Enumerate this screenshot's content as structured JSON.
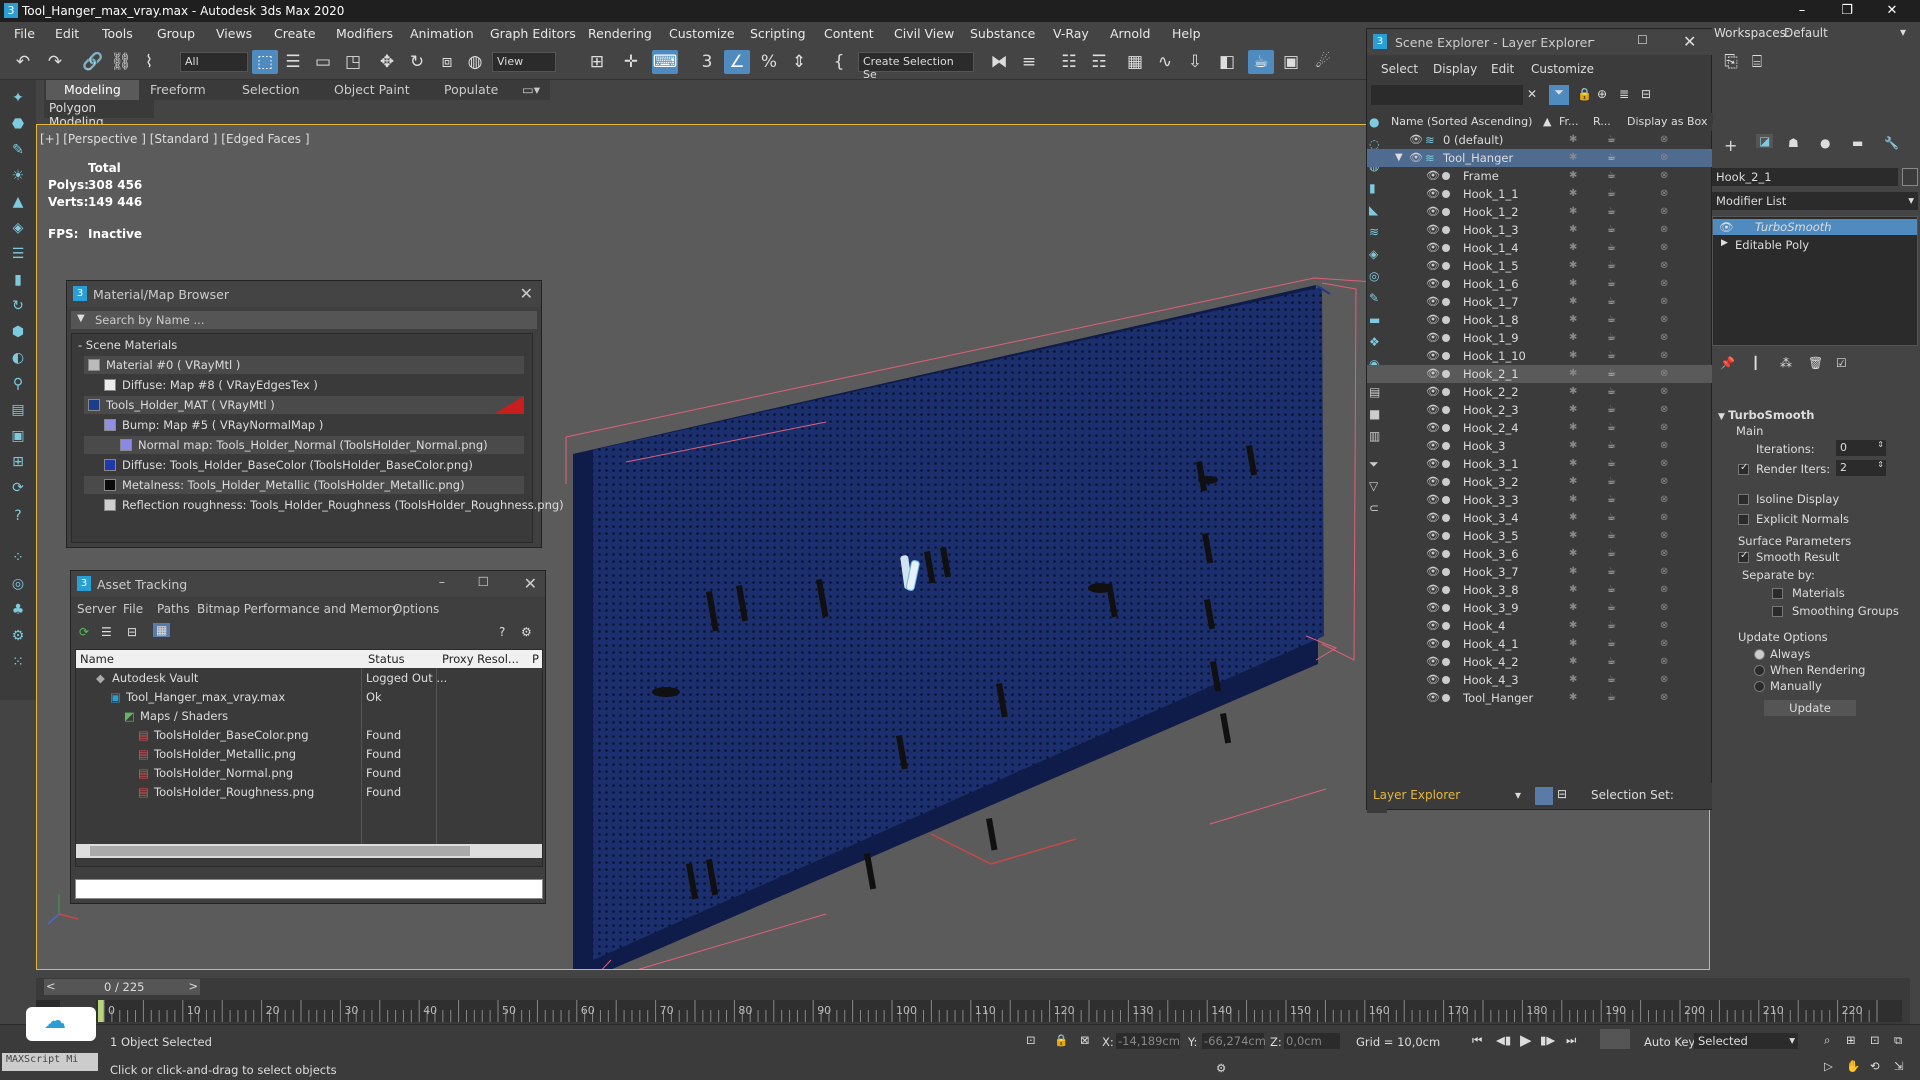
{
  "titlebar": {
    "title": "Tool_Hanger_max_vray.max - Autodesk 3ds Max 2020"
  },
  "menu": [
    "File",
    "Edit",
    "Tools",
    "Group",
    "Views",
    "Create",
    "Modifiers",
    "Animation",
    "Graph Editors",
    "Rendering",
    "Customize",
    "Scripting",
    "Content",
    "Civil View",
    "Substance",
    "V-Ray",
    "Arnold",
    "Help"
  ],
  "workspace": {
    "label": "Workspaces:",
    "value": "Default"
  },
  "toolbar": {
    "filter": "All",
    "view": "View",
    "selection_set": "Create Selection Se"
  },
  "ribbon": {
    "tabs": [
      "Modeling",
      "Freeform",
      "Selection",
      "Object Paint",
      "Populate"
    ],
    "sub": "Polygon Modeling"
  },
  "viewport": {
    "label": "[+] [Perspective ] [Standard ] [Edged Faces ]",
    "total": "Total",
    "polys_label": "Polys:",
    "polys": "308 456",
    "verts_label": "Verts:",
    "verts": "149 446",
    "fps_label": "FPS:",
    "fps": "Inactive"
  },
  "material_browser": {
    "title": "Material/Map Browser",
    "search": "Search by Name ...",
    "section": "- Scene Materials",
    "items": [
      {
        "label": "Material #0  ( VRayMtl )",
        "swatch": "#bbbbbb"
      },
      {
        "label": "Diffuse: Map #8  ( VRayEdgesTex )",
        "swatch": "#ececec"
      },
      {
        "label": "Tools_Holder_MAT  ( VRayMtl )",
        "swatch": "#1c3c8c"
      },
      {
        "label": "Bump: Map #5  ( VRayNormalMap )",
        "swatch": "#9090e0"
      },
      {
        "label": "Normal map: Tools_Holder_Normal (ToolsHolder_Normal.png)",
        "swatch": "#8a8ae6"
      },
      {
        "label": "Diffuse: Tools_Holder_BaseColor (ToolsHolder_BaseColor.png)",
        "swatch": "#1d3aa8"
      },
      {
        "label": "Metalness: Tools_Holder_Metallic (ToolsHolder_Metallic.png)",
        "swatch": "#0a0a0a"
      },
      {
        "label": "Reflection roughness: Tools_Holder_Roughness (ToolsHolder_Roughness.png)",
        "swatch": "#cfcfcf"
      }
    ]
  },
  "asset_tracking": {
    "title": "Asset Tracking",
    "menu": [
      "Server",
      "File",
      "Paths",
      "Bitmap Performance and Memory",
      "Options"
    ],
    "columns": [
      "Name",
      "Status",
      "Proxy Resol...",
      "P"
    ],
    "rows": [
      {
        "name": "Autodesk Vault",
        "status": "Logged Out ..."
      },
      {
        "name": "Tool_Hanger_max_vray.max",
        "status": "Ok"
      },
      {
        "name": "Maps / Shaders",
        "status": ""
      },
      {
        "name": "ToolsHolder_BaseColor.png",
        "status": "Found"
      },
      {
        "name": "ToolsHolder_Metallic.png",
        "status": "Found"
      },
      {
        "name": "ToolsHolder_Normal.png",
        "status": "Found"
      },
      {
        "name": "ToolsHolder_Roughness.png",
        "status": "Found"
      }
    ]
  },
  "scene_explorer": {
    "title": "Scene Explorer - Layer Explorer",
    "menu": [
      "Select",
      "Display",
      "Edit",
      "Customize"
    ],
    "columns": [
      "Name (Sorted Ascending)",
      "Fr...",
      "R...",
      "Display as Box"
    ],
    "layer_default": "0 (default)",
    "layer_tool": "Tool_Hanger",
    "objects": [
      "Frame",
      "Hook_1_1",
      "Hook_1_2",
      "Hook_1_3",
      "Hook_1_4",
      "Hook_1_5",
      "Hook_1_6",
      "Hook_1_7",
      "Hook_1_8",
      "Hook_1_9",
      "Hook_1_10",
      "Hook_2_1",
      "Hook_2_2",
      "Hook_2_3",
      "Hook_2_4",
      "Hook_3",
      "Hook_3_1",
      "Hook_3_2",
      "Hook_3_3",
      "Hook_3_4",
      "Hook_3_5",
      "Hook_3_6",
      "Hook_3_7",
      "Hook_3_8",
      "Hook_3_9",
      "Hook_4",
      "Hook_4_1",
      "Hook_4_2",
      "Hook_4_3",
      "Tool_Hanger"
    ],
    "selected": "Hook_2_1",
    "footer_label": "Layer Explorer",
    "selection_set": "Selection Set:"
  },
  "command_panel": {
    "object_name": "Hook_2_1",
    "modifier_list": "Modifier List",
    "stack": [
      "TurboSmooth",
      "Editable Poly"
    ],
    "rollout": "TurboSmooth",
    "main": "Main",
    "iterations_label": "Iterations:",
    "iterations": "0",
    "render_iters_label": "Render Iters:",
    "render_iters": "2",
    "isoline": "Isoline Display",
    "explicit": "Explicit Normals",
    "surface": "Surface Parameters",
    "smooth": "Smooth Result",
    "separate": "Separate by:",
    "materials": "Materials",
    "smoothing": "Smoothing Groups",
    "update_opts": "Update Options",
    "always": "Always",
    "when_rendering": "When Rendering",
    "manually": "Manually",
    "update": "Update"
  },
  "timeline": {
    "frame": "0 / 225",
    "ticks": [
      "0",
      "10",
      "20",
      "30",
      "40",
      "50",
      "60",
      "70",
      "80",
      "90",
      "100",
      "110",
      "120",
      "130",
      "140",
      "150",
      "160",
      "170",
      "180",
      "190",
      "200",
      "210",
      "220"
    ]
  },
  "status": {
    "selected": "1 Object Selected",
    "hint": "Click or click-and-drag to select objects",
    "maxscript": "MAXScript Mi",
    "x_label": "X:",
    "x": "-14,189cm",
    "y_label": "Y:",
    "y": "-66,274cm",
    "z_label": "Z:",
    "z": "0,0cm",
    "grid": "Grid = 10,0cm",
    "autokey": "Auto Key",
    "selected_dd": "Selected"
  }
}
